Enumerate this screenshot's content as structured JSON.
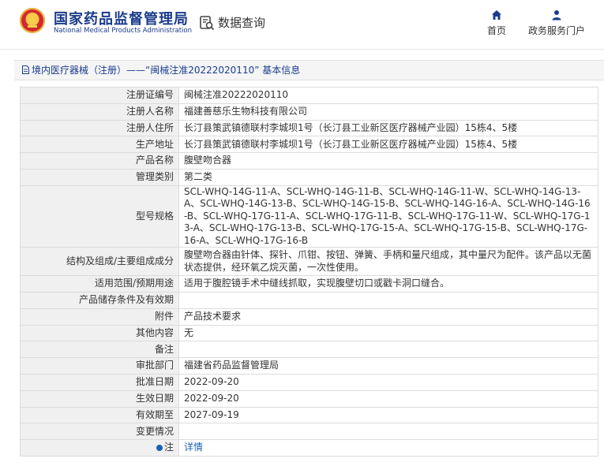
{
  "header": {
    "brand_cn": "国家药品监督管理局",
    "brand_en": "National Medical Products Administration",
    "section_title": "数据查询",
    "home_label": "首页",
    "portal_label": "政务服务门户"
  },
  "breadcrumb": {
    "category": "境内医疗器械（注册）",
    "separator": "——",
    "record": "“闽械注准20222020110”",
    "suffix": "基本信息"
  },
  "rows": [
    {
      "key": "注册证编号",
      "value": "闽械注准20222020110"
    },
    {
      "key": "注册人名称",
      "value": "福建善慈乐生物科技有限公司"
    },
    {
      "key": "注册人住所",
      "value": "长汀县策武镇德联村李城坝1号（长汀县工业新区医疗器械产业园）15栋4、5楼"
    },
    {
      "key": "生产地址",
      "value": "长汀县策武镇德联村李城坝1号（长汀县工业新区医疗器械产业园）15栋4、5楼"
    },
    {
      "key": "产品名称",
      "value": "腹壁吻合器"
    },
    {
      "key": "管理类别",
      "value": "第二类"
    },
    {
      "key": "型号规格",
      "value": "SCL-WHQ-14G-11-A、SCL-WHQ-14G-11-B、SCL-WHQ-14G-11-W、SCL-WHQ-14G-13-A、SCL-WHQ-14G-13-B、SCL-WHQ-14G-15-B、SCL-WHQ-14G-16-A、SCL-WHQ-14G-16-B、SCL-WHQ-17G-11-A、SCL-WHQ-17G-11-B、SCL-WHQ-17G-11-W、SCL-WHQ-17G-13-A、SCL-WHQ-17G-13-B、SCL-WHQ-17G-15-A、SCL-WHQ-17G-15-B、SCL-WHQ-17G-16-A、SCL-WHQ-17G-16-B"
    },
    {
      "key": "结构及组成/主要组成成分",
      "value": "腹壁吻合器由针体、探针、爪钳、按钮、弹簧、手柄和量尺组成，其中量尺为配件。该产品以无菌状态提供，经环氧乙烷灭菌，一次性使用。"
    },
    {
      "key": "适用范围/预期用途",
      "value": "适用于腹腔镜手术中缝线抓取，实现腹壁切口或戳卡洞口缝合。"
    },
    {
      "key": "产品储存条件及有效期",
      "value": ""
    },
    {
      "key": "附件",
      "value": "产品技术要求"
    },
    {
      "key": "其他内容",
      "value": "无"
    },
    {
      "key": "备注",
      "value": ""
    },
    {
      "key": "审批部门",
      "value": "福建省药品监督管理局"
    },
    {
      "key": "批准日期",
      "value": "2022-09-20"
    },
    {
      "key": "生效日期",
      "value": "2022-09-20"
    },
    {
      "key": "有效期至",
      "value": "2027-09-19"
    },
    {
      "key": "变更情况",
      "value": ""
    }
  ],
  "note_row": {
    "key": "注",
    "link": "详情"
  },
  "colors": {
    "brand": "#1b3c8c",
    "link": "#1b61b0",
    "key_bg": "#f0f0f0",
    "emblem_red": "#d3282d"
  }
}
